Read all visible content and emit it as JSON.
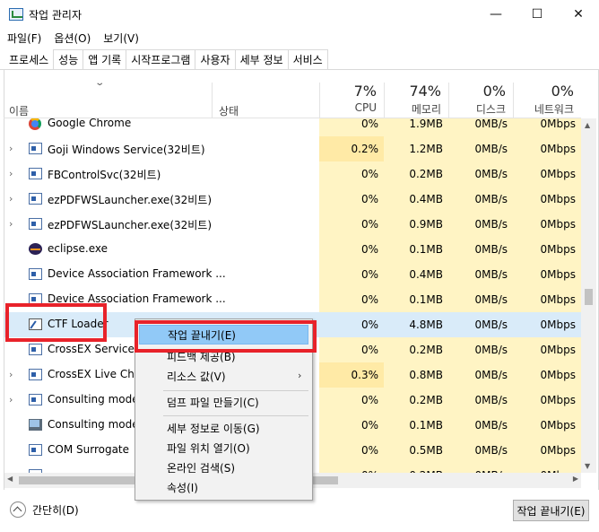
{
  "window": {
    "title": "작업 관리자",
    "min_glyph": "—",
    "max_glyph": "☐",
    "close_glyph": "✕"
  },
  "menu": [
    "파일(F)",
    "옵션(O)",
    "보기(V)"
  ],
  "tabs": [
    "프로세스",
    "성능",
    "앱 기록",
    "시작프로그램",
    "사용자",
    "세부 정보",
    "서비스"
  ],
  "header": {
    "name": "이름",
    "status": "상태",
    "metrics": [
      {
        "pct": "7%",
        "label": "CPU"
      },
      {
        "pct": "74%",
        "label": "메모리"
      },
      {
        "pct": "0%",
        "label": "디스크"
      },
      {
        "pct": "0%",
        "label": "네트워크"
      }
    ]
  },
  "rows": [
    {
      "name": "Google Chrome",
      "expand": "",
      "icon": "chrome-icon",
      "cpu": "0%",
      "mem": "1.9MB",
      "disk": "0MB/s",
      "net": "0Mbps"
    },
    {
      "name": "Goji Windows Service(32비트)",
      "expand": "›",
      "icon": "service-icon",
      "cpu": "0.2%",
      "mem": "1.2MB",
      "disk": "0MB/s",
      "net": "0Mbps"
    },
    {
      "name": "FBControlSvc(32비트)",
      "expand": "›",
      "icon": "service-icon",
      "cpu": "0%",
      "mem": "0.2MB",
      "disk": "0MB/s",
      "net": "0Mbps"
    },
    {
      "name": "ezPDFWSLauncher.exe(32비트)",
      "expand": "›",
      "icon": "app-window-icon",
      "cpu": "0%",
      "mem": "0.4MB",
      "disk": "0MB/s",
      "net": "0Mbps"
    },
    {
      "name": "ezPDFWSLauncher.exe(32비트)",
      "expand": "›",
      "icon": "app-window-icon",
      "cpu": "0%",
      "mem": "0.9MB",
      "disk": "0MB/s",
      "net": "0Mbps"
    },
    {
      "name": "eclipse.exe",
      "expand": "",
      "icon": "eclipse-icon",
      "cpu": "0%",
      "mem": "0.1MB",
      "disk": "0MB/s",
      "net": "0Mbps"
    },
    {
      "name": "Device Association Framework ...",
      "expand": "",
      "icon": "app-window-icon",
      "cpu": "0%",
      "mem": "0.4MB",
      "disk": "0MB/s",
      "net": "0Mbps"
    },
    {
      "name": "Device Association Framework ...",
      "expand": "",
      "icon": "app-window-icon",
      "cpu": "0%",
      "mem": "0.1MB",
      "disk": "0MB/s",
      "net": "0Mbps"
    },
    {
      "name": "CTF Loader",
      "expand": "",
      "icon": "ctf-loader-icon",
      "cpu": "0%",
      "mem": "4.8MB",
      "disk": "0MB/s",
      "net": "0Mbps"
    },
    {
      "name": "CrossEX Service(3",
      "expand": "",
      "icon": "app-window-icon",
      "cpu": "0%",
      "mem": "0.2MB",
      "disk": "0MB/s",
      "net": "0Mbps"
    },
    {
      "name": "CrossEX Live Chec",
      "expand": "›",
      "icon": "app-window-icon",
      "cpu": "0.3%",
      "mem": "0.8MB",
      "disk": "0MB/s",
      "net": "0Mbps"
    },
    {
      "name": "Consulting mode",
      "expand": "›",
      "icon": "app-window-icon",
      "cpu": "0%",
      "mem": "0.2MB",
      "disk": "0MB/s",
      "net": "0Mbps"
    },
    {
      "name": "Consulting mode",
      "expand": "",
      "icon": "consulting-icon",
      "cpu": "0%",
      "mem": "0.1MB",
      "disk": "0MB/s",
      "net": "0Mbps"
    },
    {
      "name": "COM Surrogate",
      "expand": "",
      "icon": "app-window-icon",
      "cpu": "0%",
      "mem": "0.5MB",
      "disk": "0MB/s",
      "net": "0Mbps"
    },
    {
      "name": "",
      "expand": "",
      "icon": "app-window-icon",
      "cpu": "0%",
      "mem": "0.2MB",
      "disk": "0MB/s",
      "net": "0Mbps"
    }
  ],
  "context_menu": {
    "end_task": "작업 끝내기(E)",
    "feedback": "피드백 제공(B)",
    "resource_values": "리소스 값(V)",
    "dump": "덤프 파일 만들기(C)",
    "go_details": "세부 정보로 이동(G)",
    "open_location": "파일 위치 열기(O)",
    "search_online": "온라인 검색(S)",
    "properties": "속성(I)",
    "submenu_arrow": "›"
  },
  "footer": {
    "collapse": "간단히(D)",
    "end_task": "작업 끝내기(E)"
  },
  "colors": {
    "highlight": "#91c9f7",
    "selected_row": "#d9ebf9",
    "heat_light": "#fff4c4",
    "heat_strong": "#ffeaa6",
    "annotation_red": "#e8222a"
  }
}
